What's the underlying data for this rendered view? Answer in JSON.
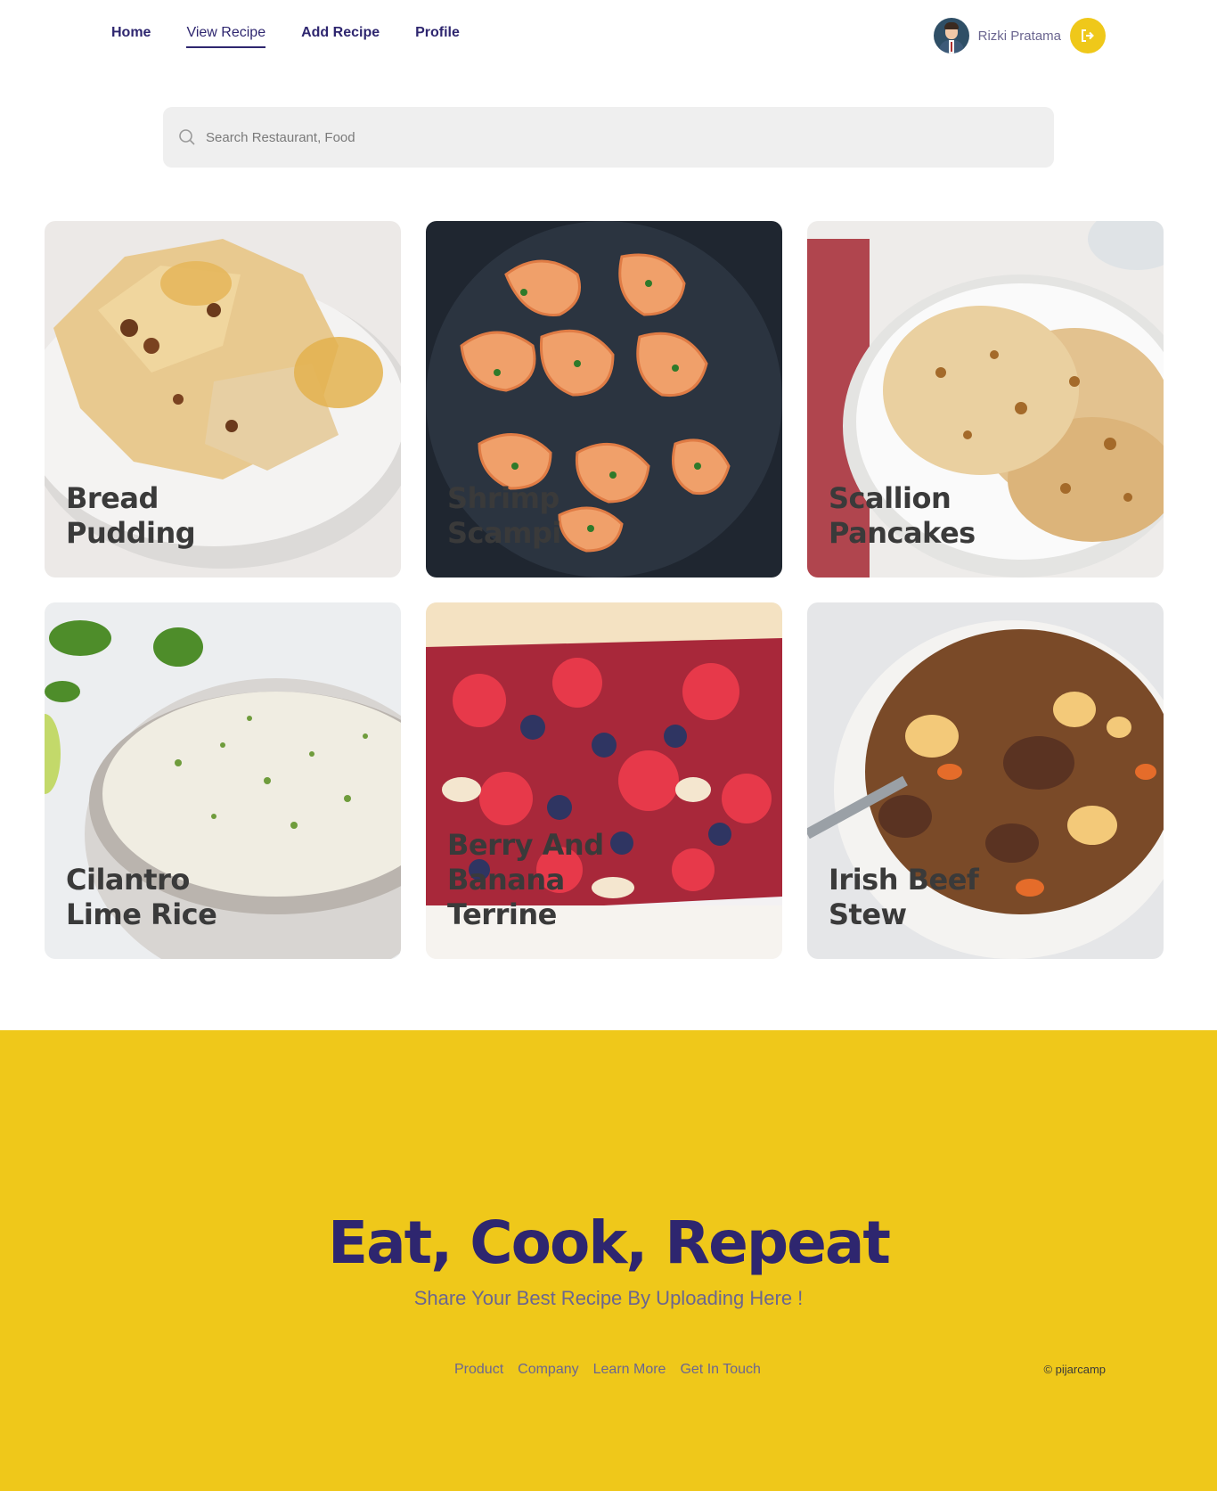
{
  "nav": {
    "links": [
      {
        "label": "Home"
      },
      {
        "label": "View Recipe"
      },
      {
        "label": "Add Recipe"
      },
      {
        "label": "Profile"
      }
    ],
    "active_index": 1,
    "user_name": "Rizki Pratama",
    "logout_icon": "logout-icon"
  },
  "search": {
    "placeholder": "Search Restaurant, Food",
    "value": ""
  },
  "recipes": [
    {
      "title": "Bread Pudding",
      "image": "bread-pudding-image"
    },
    {
      "title": "Shrimp Scampi",
      "image": "shrimp-scampi-image"
    },
    {
      "title": "Scallion Pancakes",
      "image": "scallion-pancakes-image"
    },
    {
      "title": "Cilantro Lime Rice",
      "image": "cilantro-lime-rice-image"
    },
    {
      "title": "Berry And Banana Terrine",
      "image": "berry-banana-terrine-image"
    },
    {
      "title": "Irish Beef Stew",
      "image": "irish-beef-stew-image"
    }
  ],
  "hero": {
    "title": "Eat, Cook, Repeat",
    "subtitle": "Share Your Best Recipe By Uploading Here !"
  },
  "footer": {
    "links": [
      "Product",
      "Company",
      "Learn More",
      "Get In Touch"
    ],
    "copyright": "© pijarcamp"
  },
  "colors": {
    "accent": "#efc81a",
    "primary": "#2e266f"
  }
}
